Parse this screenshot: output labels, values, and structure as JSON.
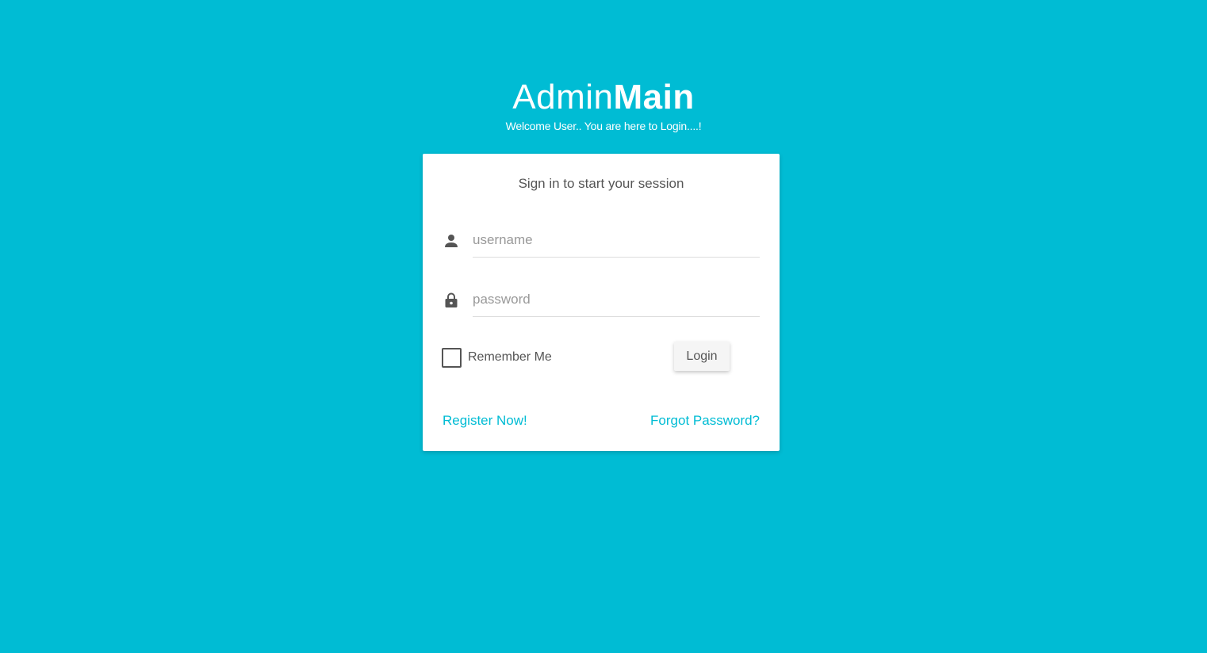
{
  "logo": {
    "title_light": "Admin",
    "title_bold": "Main",
    "subtitle": "Welcome User.. You are here to Login....!"
  },
  "login_card": {
    "message": "Sign in to start your session",
    "username": {
      "placeholder": "username",
      "value": "",
      "icon": "person-icon"
    },
    "password": {
      "placeholder": "password",
      "value": "",
      "icon": "lock-icon"
    },
    "remember_label": "Remember Me",
    "remember_checked": false,
    "login_label": "Login",
    "register_link": "Register Now!",
    "forgot_link": "Forgot Password?"
  },
  "colors": {
    "background": "#00bcd4",
    "accent": "#00bcd4",
    "card": "#ffffff",
    "text": "#555555"
  }
}
